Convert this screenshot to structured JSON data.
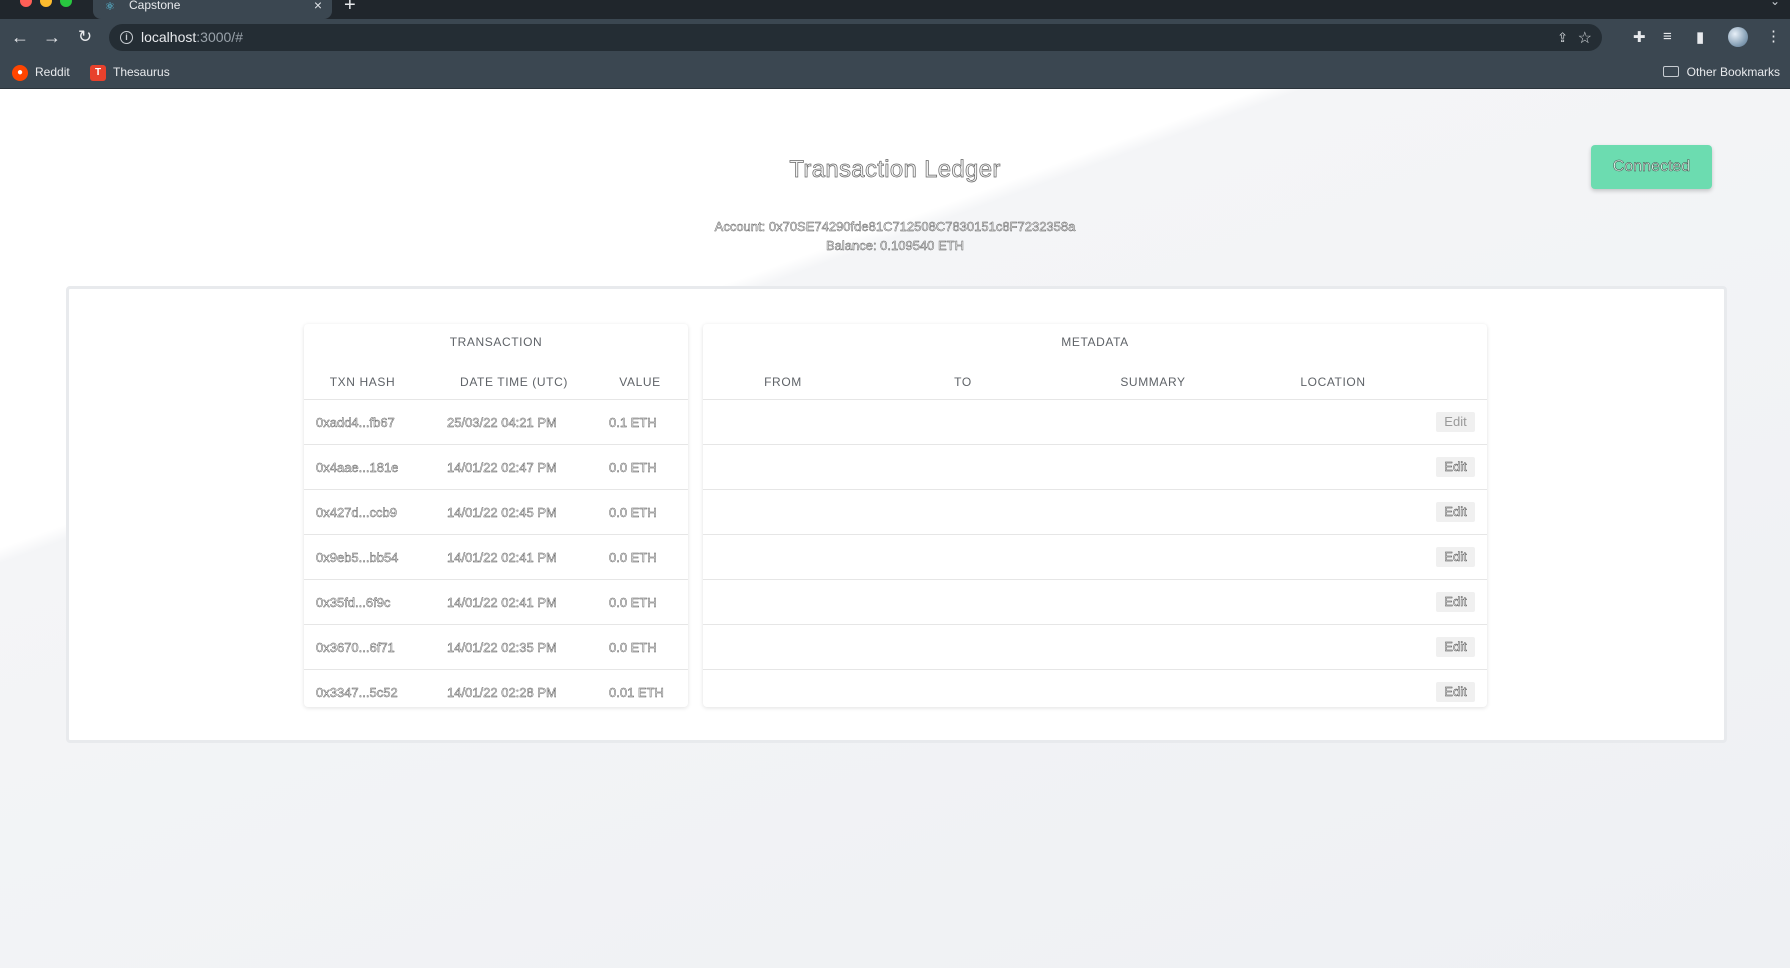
{
  "browser": {
    "tab_title": "Capstone",
    "url_host": "localhost",
    "url_rest": ":3000/#",
    "bookmarks": [
      "Reddit",
      "Thesaurus"
    ],
    "other_bookmarks": "Other Bookmarks"
  },
  "header": {
    "title": "Transaction Ledger",
    "connect_label": "Connected",
    "account_line": "Account: 0x70SE74290fde81C712508C7830151c8F7232358a",
    "balance_line": "Balance: 0.109540 ETH"
  },
  "table": {
    "group_transaction": "TRANSACTION",
    "group_metadata": "METADATA",
    "columns": [
      "TXN HASH",
      "DATE TIME (UTC)",
      "VALUE",
      "FROM",
      "TO",
      "SUMMARY",
      "LOCATION"
    ],
    "edit_label": "Edit",
    "rows": [
      {
        "hash": "0xadd4...fb67",
        "datetime": "25/03/22 04:21 PM",
        "value": "0.1 ETH"
      },
      {
        "hash": "0x4aae...181e",
        "datetime": "14/01/22 02:47 PM",
        "value": "0.0 ETH"
      },
      {
        "hash": "0x427d...ccb9",
        "datetime": "14/01/22 02:45 PM",
        "value": "0.0 ETH"
      },
      {
        "hash": "0x9eb5...bb54",
        "datetime": "14/01/22 02:41 PM",
        "value": "0.0 ETH"
      },
      {
        "hash": "0x35fd...6f9c",
        "datetime": "14/01/22 02:41 PM",
        "value": "0.0 ETH"
      },
      {
        "hash": "0x3670...6f71",
        "datetime": "14/01/22 02:35 PM",
        "value": "0.0 ETH"
      },
      {
        "hash": "0x3347...5c52",
        "datetime": "14/01/22 02:28 PM",
        "value": "0.01 ETH"
      }
    ]
  }
}
